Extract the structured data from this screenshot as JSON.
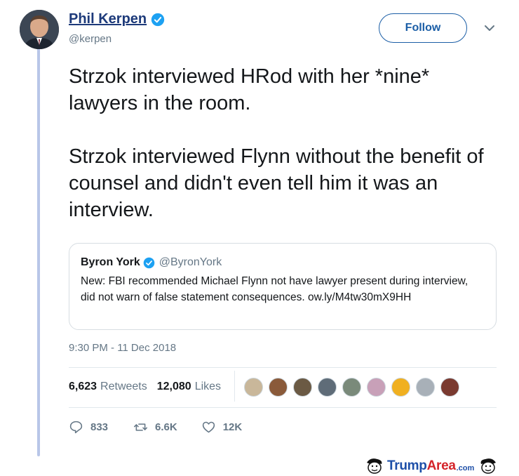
{
  "author": {
    "name": "Phil Kerpen",
    "handle": "@kerpen",
    "verified": true
  },
  "follow_button": {
    "label": "Follow"
  },
  "tweet": {
    "text": "Strzok interviewed HRod with her *nine* lawyers in the room.\n\nStrzok interviewed Flynn without the benefit of counsel and didn't even tell him it was an interview.",
    "timestamp": "9:30 PM - 11 Dec 2018"
  },
  "quoted_tweet": {
    "name": "Byron York",
    "handle": "@ByronYork",
    "verified": true,
    "text": "New: FBI recommended Michael Flynn not have lawyer present during interview, did not warn of false statement consequences. ow.ly/M4tw30mX9HH"
  },
  "stats": {
    "retweets_count": "6,623",
    "retweets_label": "Retweets",
    "likes_count": "12,080",
    "likes_label": "Likes"
  },
  "liker_avatars": [
    "#c9b79a",
    "#8a5a3a",
    "#6b5a44",
    "#5f6c78",
    "#7a8a7a",
    "#c8a0b8",
    "#f0b020",
    "#a8b0b8",
    "#7a3a30"
  ],
  "actions": {
    "replies": "833",
    "retweets": "6.6K",
    "likes": "12K"
  },
  "watermark": {
    "brand_part1": "Trump",
    "brand_part2": "Area",
    "suffix": ".com"
  },
  "colors": {
    "name_link": "#1d3a7a",
    "follow_blue": "#1b5ea6",
    "verified_blue": "#1da1f2",
    "secondary_text": "#657786",
    "thread_line": "#b8c6e8"
  }
}
